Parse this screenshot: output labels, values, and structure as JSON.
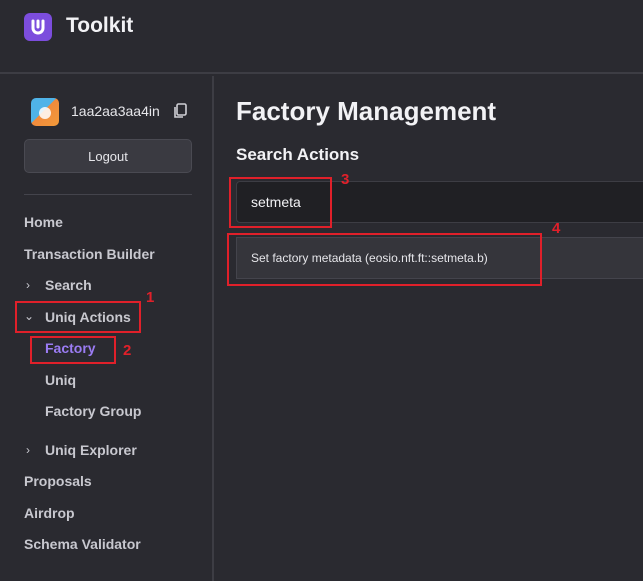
{
  "app": {
    "title": "Toolkit",
    "logo_letter": "U",
    "accent": "#7c4ddd"
  },
  "account": {
    "name": "1aa2aa3aa4in",
    "avatar_icon": "avatar-icon",
    "copy_icon": "copy-icon"
  },
  "sidebar": {
    "logout_label": "Logout",
    "items": [
      {
        "label": "Home"
      },
      {
        "label": "Transaction Builder"
      },
      {
        "label": "Search",
        "expandable": true,
        "expanded": false
      },
      {
        "label": "Uniq Actions",
        "expandable": true,
        "expanded": true
      },
      {
        "label": "Factory",
        "active": true
      },
      {
        "label": "Uniq"
      },
      {
        "label": "Factory Group"
      },
      {
        "label": "Uniq Explorer",
        "expandable": true,
        "expanded": false
      },
      {
        "label": "Proposals"
      },
      {
        "label": "Airdrop"
      },
      {
        "label": "Schema Validator"
      }
    ],
    "active_color": "#9b7cf4"
  },
  "main": {
    "title": "Factory Management",
    "section_title": "Search Actions",
    "search_value": "setmeta",
    "results": [
      {
        "label": "Set factory metadata (eosio.nft.ft::setmeta.b)"
      }
    ]
  },
  "annotations": {
    "color": "#e0202a",
    "labels": [
      "1",
      "2",
      "3",
      "4"
    ]
  }
}
